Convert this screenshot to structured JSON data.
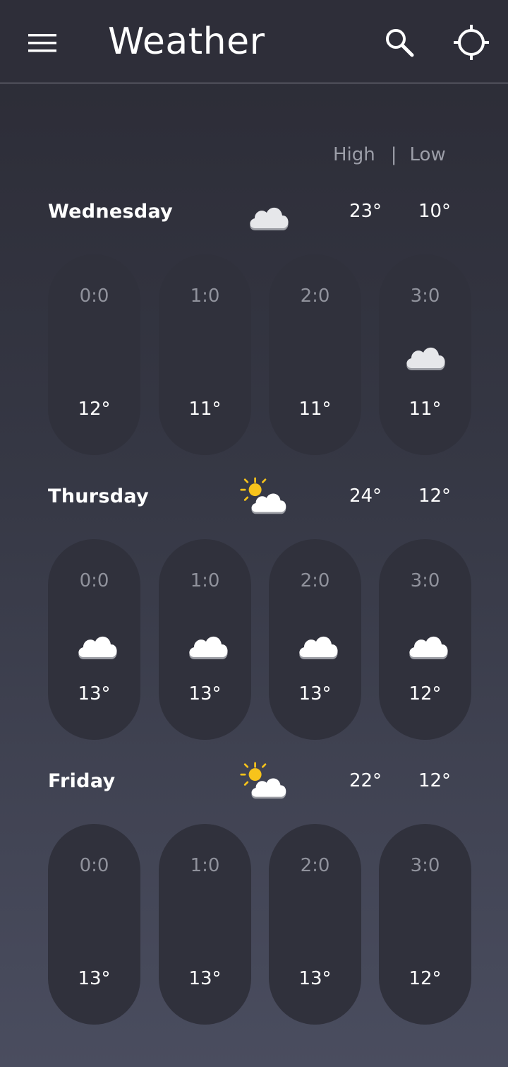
{
  "app": {
    "title": "Weather"
  },
  "legend": {
    "high": "High",
    "separator": "|",
    "low": "Low"
  },
  "days": [
    {
      "name": "Wednesday",
      "icon": "cloud-icon",
      "high": "23°",
      "low": "10°",
      "hours": [
        {
          "time": "0:0",
          "icon": "moon-icon",
          "temp": "12°"
        },
        {
          "time": "1:0",
          "icon": "moon-icon",
          "temp": "11°"
        },
        {
          "time": "2:0",
          "icon": "moon-icon",
          "temp": "11°"
        },
        {
          "time": "3:0",
          "icon": "cloud-icon",
          "temp": "11°"
        }
      ]
    },
    {
      "name": "Thursday",
      "icon": "partly-sunny-icon",
      "high": "24°",
      "low": "12°",
      "hours": [
        {
          "time": "0:0",
          "icon": "moon-cloud-icon",
          "temp": "13°"
        },
        {
          "time": "1:0",
          "icon": "moon-cloud-icon",
          "temp": "13°"
        },
        {
          "time": "2:0",
          "icon": "moon-cloud-icon",
          "temp": "13°"
        },
        {
          "time": "3:0",
          "icon": "moon-cloud-icon",
          "temp": "12°"
        }
      ]
    },
    {
      "name": "Friday",
      "icon": "partly-sunny-icon",
      "high": "22°",
      "low": "12°",
      "hours": [
        {
          "time": "0:0",
          "icon": "moon-icon",
          "temp": "13°"
        },
        {
          "time": "1:0",
          "icon": "moon-icon",
          "temp": "13°"
        },
        {
          "time": "2:0",
          "icon": "moon-icon",
          "temp": "13°"
        },
        {
          "time": "3:0",
          "icon": "moon-icon",
          "temp": "12°"
        }
      ]
    }
  ],
  "colors": {
    "appbar": "#2e2e39",
    "pill": "#30313c",
    "muted_text": "#90929c",
    "moon": "#1f6fd6",
    "sun": "#f7c31b",
    "cloud": "#e6e7ea"
  }
}
